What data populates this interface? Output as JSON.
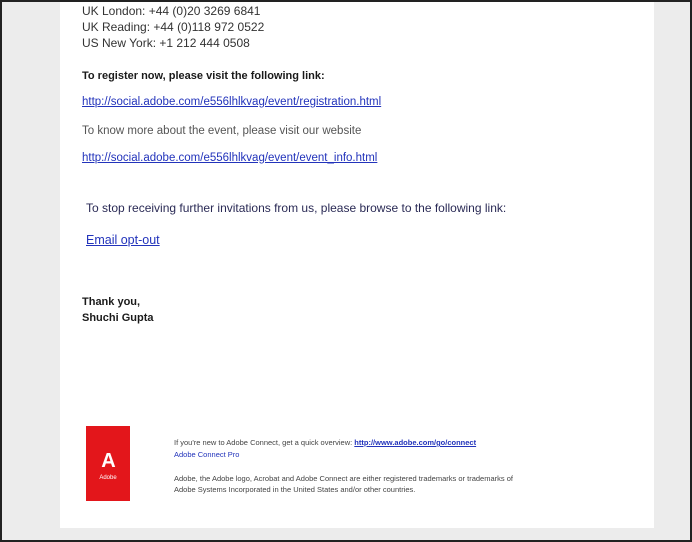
{
  "phones": [
    "UK London: +44 (0)20 3269 6841",
    "UK Reading: +44 (0)118 972 0522",
    "US New York: +1 212 444 0508"
  ],
  "register": {
    "heading": "To register now, please visit the following link:",
    "link": "http://social.adobe.com/e556lhlkvag/event/registration.html"
  },
  "more_info": {
    "text": "To know more about the event, please visit our website",
    "link": "http://social.adobe.com/e556lhlkvag/event/event_info.html"
  },
  "unsubscribe": {
    "text": "To stop receiving further invitations from us, please browse to the following link:",
    "link": "Email opt-out"
  },
  "signature": {
    "closing": "Thank you,",
    "name": "Shuchi Gupta"
  },
  "logo": {
    "mark": "A",
    "word": "Adobe",
    "color": "#e3161b"
  },
  "footer": {
    "line1": "If you're new to Adobe Connect, get a quick overview:",
    "line1_link": "http://www.adobe.com/go/connect",
    "line2": "Adobe Connect Pro",
    "legal1": "Adobe, the Adobe logo, Acrobat and Adobe Connect are either registered trademarks or trademarks of",
    "legal2": "Adobe Systems Incorporated in the United States and/or other countries."
  },
  "colors": {
    "link": "#2233bb",
    "text": "#1a1a1a"
  }
}
